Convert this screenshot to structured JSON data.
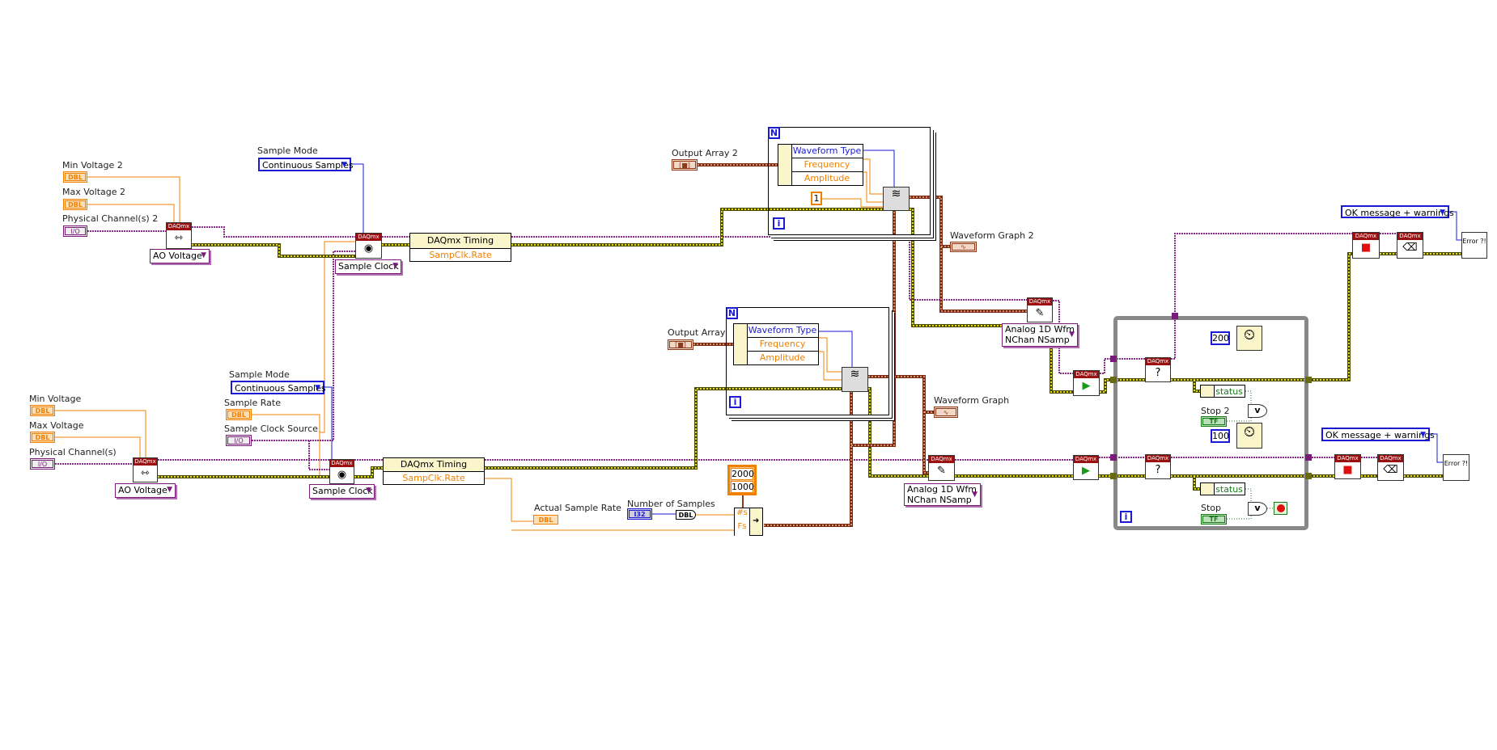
{
  "daqmx_label": "DAQmx",
  "channel2": {
    "min_voltage": {
      "label": "Min Voltage 2",
      "type": "DBL"
    },
    "max_voltage": {
      "label": "Max Voltage 2",
      "type": "DBL"
    },
    "physical_channel": {
      "label": "Physical Channel(s) 2",
      "type": "I/O"
    },
    "ao_ring": "AO Voltage",
    "sample_mode": {
      "label": "Sample Mode",
      "value": "Continuous Samples"
    },
    "sample_clock_ring": "Sample Clock",
    "timing_node": {
      "title": "DAQmx Timing",
      "property": "SampClk.Rate"
    },
    "output_array": {
      "label": "Output Array 2",
      "type": "[■]"
    },
    "unbundle": [
      "Waveform Type",
      "Frequency",
      "Amplitude"
    ],
    "const_one": "1",
    "waveform_graph": "Waveform Graph 2",
    "write_ring": [
      "Analog 1D Wfm",
      "NChan NSamp"
    ],
    "error_ring": "OK message + warnings",
    "wait_ms": "200",
    "stop": "Stop 2",
    "status": "status"
  },
  "channel1": {
    "min_voltage": {
      "label": "Min Voltage",
      "type": "DBL"
    },
    "max_voltage": {
      "label": "Max Voltage",
      "type": "DBL"
    },
    "physical_channel": {
      "label": "Physical Channel(s)",
      "type": "I/O"
    },
    "ao_ring": "AO Voltage",
    "sample_mode": {
      "label": "Sample Mode",
      "value": "Continuous Samples"
    },
    "sample_rate": {
      "label": "Sample Rate",
      "type": "DBL"
    },
    "sample_clock_source": {
      "label": "Sample Clock Source",
      "type": "I/O"
    },
    "sample_clock_ring": "Sample Clock",
    "timing_node": {
      "title": "DAQmx Timing",
      "property": "SampClk.Rate"
    },
    "actual_sample_rate": {
      "label": "Actual Sample Rate",
      "type": "DBL"
    },
    "number_of_samples": {
      "label": "Number of Samples",
      "type": "I32"
    },
    "to_dbl": "DBL",
    "array_const": [
      "2000",
      "1000"
    ],
    "build_inputs": [
      "#s",
      "Fs"
    ],
    "output_array": {
      "label": "Output Array",
      "type": "[■]"
    },
    "unbundle": [
      "Waveform Type",
      "Frequency",
      "Amplitude"
    ],
    "waveform_graph": "Waveform Graph",
    "write_ring": [
      "Analog 1D Wfm",
      "NChan NSamp"
    ],
    "error_ring": "OK message + warnings",
    "wait_ms": "100",
    "stop": "Stop",
    "status": "status"
  },
  "loop_labels": {
    "for_n": "N",
    "iteration": "i"
  },
  "bool_type": "TF",
  "or_label": "v",
  "error_text": "Error ?!",
  "colors": {
    "dbl": "#f08000",
    "io": "#7a1a7a",
    "enum": "#1a1ad6",
    "waveform": "#8b3a1a",
    "error": "#d8d800",
    "bool": "#1a7a1a",
    "daqmx_header": "#9a1010"
  }
}
